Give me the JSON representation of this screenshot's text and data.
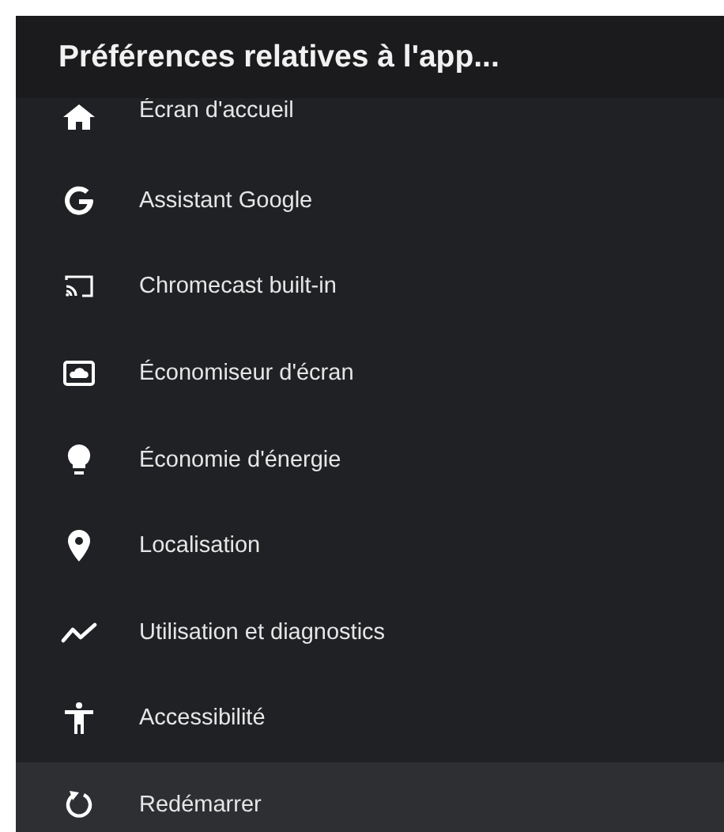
{
  "header": {
    "title": "Préférences relatives à l'app..."
  },
  "items": [
    {
      "label": "Écran d'accueil",
      "kind": "home",
      "selected": false
    },
    {
      "label": "Assistant Google",
      "kind": "google",
      "selected": false
    },
    {
      "label": "Chromecast built-in",
      "kind": "cast",
      "selected": false
    },
    {
      "label": "Économiseur d'écran",
      "kind": "screensaver",
      "selected": false
    },
    {
      "label": "Économie d'énergie",
      "kind": "bulb",
      "selected": false
    },
    {
      "label": "Localisation",
      "kind": "pin",
      "selected": false
    },
    {
      "label": "Utilisation et diagnostics",
      "kind": "chart",
      "selected": false
    },
    {
      "label": "Accessibilité",
      "kind": "person",
      "selected": false
    },
    {
      "label": "Redémarrer",
      "kind": "restart",
      "selected": true
    }
  ]
}
